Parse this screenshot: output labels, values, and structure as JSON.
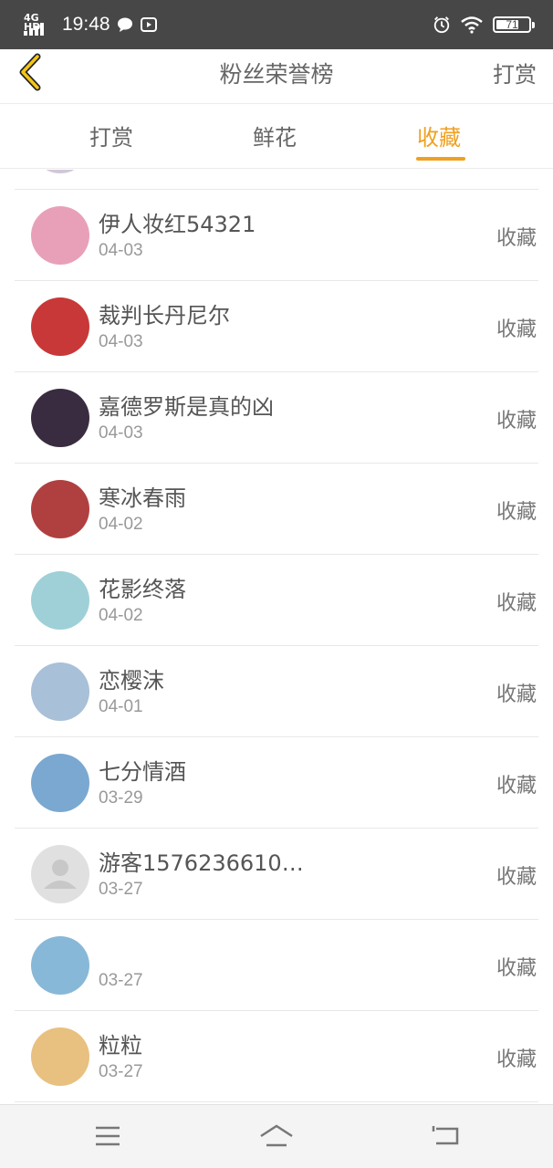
{
  "status_bar": {
    "network": "4G HD",
    "time": "19:48",
    "battery": "71",
    "battery_level": 0.71
  },
  "header": {
    "title": "粉丝荣誉榜",
    "right_action": "打赏"
  },
  "tabs": [
    {
      "label": "打赏",
      "active": false
    },
    {
      "label": "鲜花",
      "active": false
    },
    {
      "label": "收藏",
      "active": true
    }
  ],
  "list": {
    "items": [
      {
        "name": "伊人妆红54321",
        "date": "04-03",
        "action": "收藏",
        "avatar_color": "#e8a0b8"
      },
      {
        "name": "裁判长丹尼尔",
        "date": "04-03",
        "action": "收藏",
        "avatar_color": "#c83838"
      },
      {
        "name": "嘉德罗斯是真的凶",
        "date": "04-03",
        "action": "收藏",
        "avatar_color": "#3a2c40"
      },
      {
        "name": "寒冰春雨",
        "date": "04-02",
        "action": "收藏",
        "avatar_color": "#b04040"
      },
      {
        "name": "花影终落",
        "date": "04-02",
        "action": "收藏",
        "avatar_color": "#9fd0d8"
      },
      {
        "name": "恋樱沫",
        "date": "04-01",
        "action": "收藏",
        "avatar_color": "#a8c0d8"
      },
      {
        "name": "七分情酒",
        "date": "03-29",
        "action": "收藏",
        "avatar_color": "#7aa8d0"
      },
      {
        "name": "游客1576236610…",
        "date": "03-27",
        "action": "收藏",
        "avatar_color": "#e0e0e0"
      },
      {
        "name": "",
        "date": "03-27",
        "action": "收藏",
        "avatar_color": "#88b8d8"
      },
      {
        "name": "粒粒",
        "date": "03-27",
        "action": "收藏",
        "avatar_color": "#e8c080"
      }
    ]
  },
  "colors": {
    "accent": "#f0a020",
    "status_bar_bg": "#474747",
    "text_primary": "#555555",
    "text_secondary": "#999999"
  }
}
